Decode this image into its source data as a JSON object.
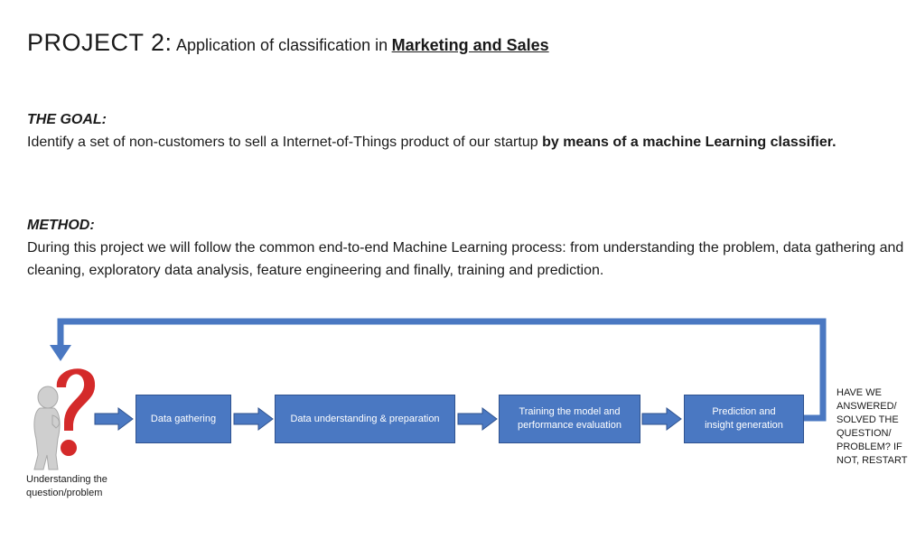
{
  "header": {
    "project": "PROJECT 2:",
    "subtitle": "Application of classification in",
    "highlight": "Marketing and Sales"
  },
  "goal": {
    "label": "THE GOAL:",
    "text": "Identify a set of non-customers to sell a Internet-of-Things product of our startup",
    "text_bold": "by means of a machine Learning classifier."
  },
  "method": {
    "label": "METHOD:",
    "text": "During this project we will follow the common end-to-end Machine Learning process: from understanding the problem, data gathering and cleaning, exploratory data analysis, feature engineering and finally, training and prediction."
  },
  "process": {
    "start_caption_line1": "Understanding the",
    "start_caption_line2": "question/problem",
    "steps": [
      {
        "line1": "Data gathering",
        "line2": ""
      },
      {
        "line1": "Data understanding & preparation",
        "line2": ""
      },
      {
        "line1": "Training the model and",
        "line2": "performance evaluation"
      },
      {
        "line1": "Prediction and",
        "line2": "insight generation"
      }
    ],
    "restart_text": "HAVE WE ANSWERED/ SOLVED THE QUESTION/ PROBLEM? IF NOT, RESTART",
    "colors": {
      "box": "#4a78c2",
      "arrow": "#4a78c2",
      "question_mark": "#d42a2a",
      "figure": "#c8c8c8"
    }
  },
  "icons": [
    "thinking-figure-icon",
    "question-mark-icon"
  ]
}
